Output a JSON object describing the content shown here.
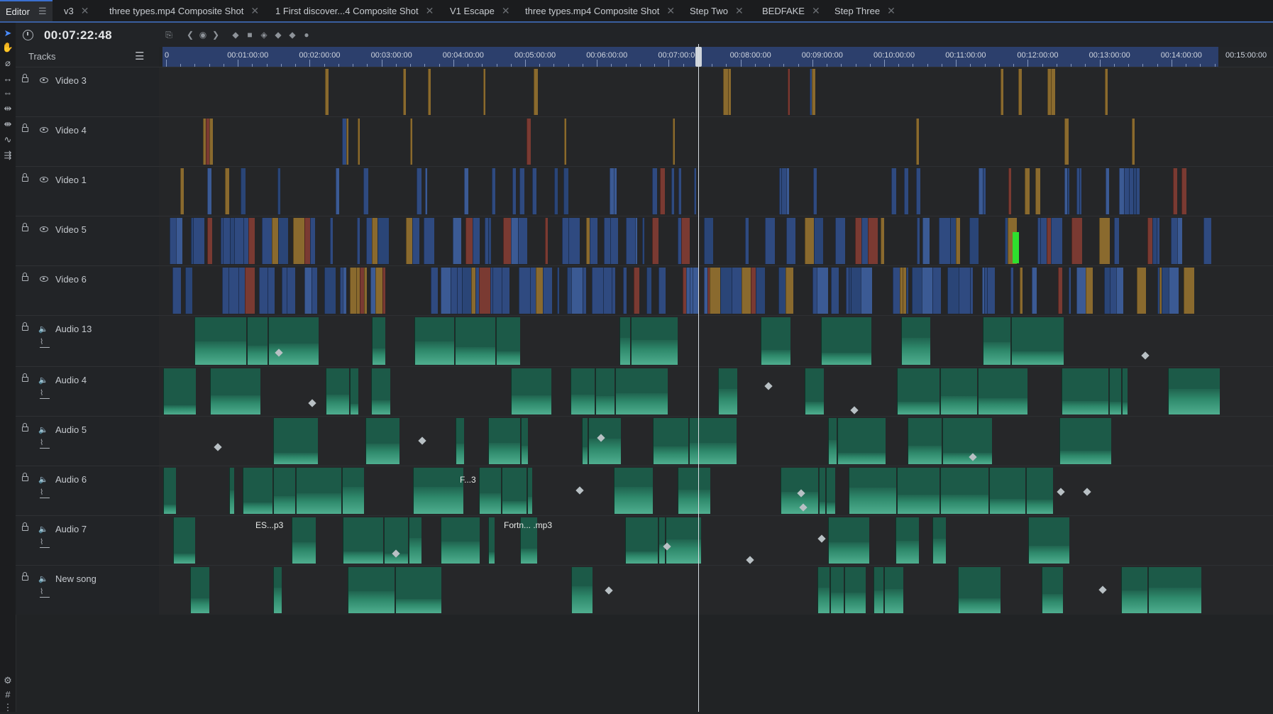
{
  "tabs": [
    {
      "label": "Editor",
      "active": true
    },
    {
      "label": "v3"
    },
    {
      "label": "three types.mp4 Composite Shot"
    },
    {
      "label": "1 First discover...4 Composite Shot"
    },
    {
      "label": "V1 Escape"
    },
    {
      "label": "three types.mp4 Composite Shot"
    },
    {
      "label": "Step Two"
    },
    {
      "label": "BEDFAKE"
    },
    {
      "label": "Step Three"
    }
  ],
  "header": {
    "timecode": "00:07:22:48",
    "tracks_label": "Tracks"
  },
  "ruler": {
    "labels": [
      "0",
      "00:01:00:00",
      "00:02:00:00",
      "00:03:00:00",
      "00:04:00:00",
      "00:05:00:00",
      "00:06:00:00",
      "00:07:00:00",
      "00:08:00:00",
      "00:09:00:00",
      "00:10:00:00",
      "00:11:00:00",
      "00:12:00:00",
      "00:13:00:00",
      "00:14:00:00",
      "00:15:00:00"
    ]
  },
  "tracks": [
    {
      "name": "Video 3",
      "kind": "video"
    },
    {
      "name": "Video 4",
      "kind": "video"
    },
    {
      "name": "Video 1",
      "kind": "video"
    },
    {
      "name": "Video 5",
      "kind": "video"
    },
    {
      "name": "Video 6",
      "kind": "video"
    },
    {
      "name": "Audio 13",
      "kind": "audio"
    },
    {
      "name": "Audio 4",
      "kind": "audio"
    },
    {
      "name": "Audio 5",
      "kind": "audio"
    },
    {
      "name": "Audio 6",
      "kind": "audio"
    },
    {
      "name": "Audio 7",
      "kind": "audio"
    },
    {
      "name": "New song",
      "kind": "audio"
    }
  ],
  "clip_labels": [
    {
      "track": 8,
      "text": "F...3"
    },
    {
      "track": 9,
      "text": "ES...p3"
    },
    {
      "track": 9,
      "text": "Fortn... .mp3"
    }
  ],
  "colors": {
    "accent": "#3a6fd0",
    "video_clip_blue": "#2f4a80",
    "video_clip_gold": "#8a6a2e",
    "video_clip_red": "#7a3a32",
    "audio_clip": "#1f6a55",
    "audio_waveform": "#4fae8f",
    "ruler": "#2c3f6c"
  }
}
